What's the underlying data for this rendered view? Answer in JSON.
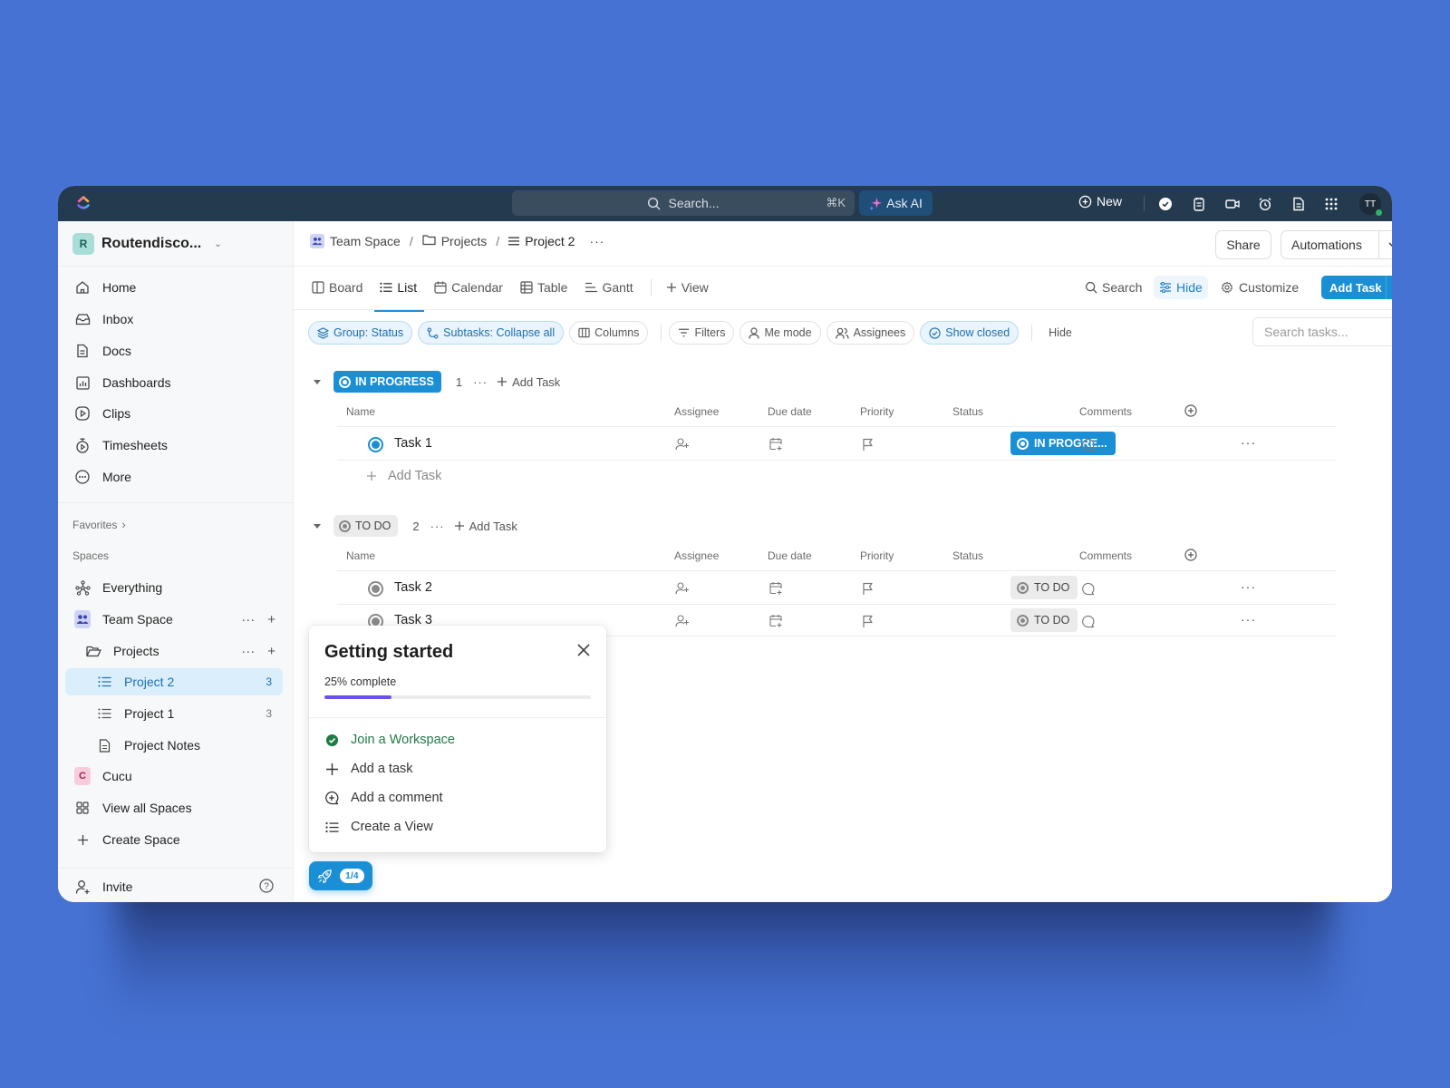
{
  "topbar": {
    "search_placeholder": "Search...",
    "search_shortcut": "⌘K",
    "ask_ai_label": "Ask AI",
    "new_label": "New",
    "icons": [
      "check-circle-icon",
      "notepad-icon",
      "video-icon",
      "alarm-clock-icon",
      "document-icon",
      "apps-grid-icon"
    ],
    "user_initials": "TT"
  },
  "sidebar": {
    "workspace": {
      "initial": "R",
      "name": "Routendisco..."
    },
    "nav": [
      {
        "label": "Home",
        "icon": "home-icon"
      },
      {
        "label": "Inbox",
        "icon": "inbox-icon"
      },
      {
        "label": "Docs",
        "icon": "docs-icon"
      },
      {
        "label": "Dashboards",
        "icon": "dashboards-icon"
      },
      {
        "label": "Clips",
        "icon": "clips-icon"
      },
      {
        "label": "Timesheets",
        "icon": "timer-icon"
      },
      {
        "label": "More",
        "icon": "more-icon"
      }
    ],
    "favorites_label": "Favorites",
    "spaces_label": "Spaces",
    "spaces": [
      {
        "label": "Everything",
        "icon": "everything-icon"
      },
      {
        "label": "Team Space",
        "icon": "team-icon"
      },
      {
        "label": "Projects",
        "icon": "folder-icon"
      },
      {
        "label": "Project 2",
        "icon": "list-icon",
        "count": "3",
        "active": true
      },
      {
        "label": "Project 1",
        "icon": "list-icon",
        "count": "3"
      },
      {
        "label": "Project Notes",
        "icon": "doc-icon"
      },
      {
        "label": "Cucu",
        "initial": "C"
      },
      {
        "label": "View all Spaces",
        "icon": "grid-icon"
      },
      {
        "label": "Create Space",
        "icon": "plus-icon"
      }
    ],
    "invite_label": "Invite"
  },
  "header": {
    "breadcrumb": [
      "Team Space",
      "Projects",
      "Project 2"
    ],
    "share_label": "Share",
    "automations_label": "Automations"
  },
  "views": {
    "tabs": [
      {
        "label": "Board"
      },
      {
        "label": "List",
        "active": true
      },
      {
        "label": "Calendar"
      },
      {
        "label": "Table"
      },
      {
        "label": "Gantt"
      }
    ],
    "add_view_label": "View",
    "search_label": "Search",
    "hide_label": "Hide",
    "customize_label": "Customize",
    "add_task_label": "Add Task"
  },
  "filters": {
    "group": "Group: Status",
    "subtasks": "Subtasks: Collapse all",
    "columns": "Columns",
    "filters": "Filters",
    "me_mode": "Me mode",
    "assignees": "Assignees",
    "show_closed": "Show closed",
    "hide": "Hide",
    "search_placeholder": "Search tasks..."
  },
  "columns": [
    "Name",
    "Assignee",
    "Due date",
    "Priority",
    "Status",
    "Comments"
  ],
  "groups": [
    {
      "status": "IN PROGRESS",
      "count": "1",
      "add_label": "Add Task",
      "color": "#1b8fd6",
      "tasks": [
        {
          "name": "Task 1",
          "status": "IN PROGRE..."
        }
      ],
      "add_row_label": "Add Task"
    },
    {
      "status": "TO DO",
      "count": "2",
      "add_label": "Add Task",
      "color": "#8a8a8a",
      "tasks": [
        {
          "name": "Task 2",
          "status": "TO DO"
        },
        {
          "name": "Task 3",
          "status": "TO DO"
        }
      ]
    }
  ],
  "getting_started": {
    "title": "Getting started",
    "progress_label": "25% complete",
    "progress": 0.25,
    "items": [
      {
        "label": "Join a Workspace",
        "done": true
      },
      {
        "label": "Add a task",
        "done": false
      },
      {
        "label": "Add a comment",
        "done": false
      },
      {
        "label": "Create a View",
        "done": false
      }
    ],
    "badge": "1/4"
  },
  "colors": {
    "accent": "#1b8fd6",
    "topbar": "#243a4f",
    "background": "#4672d3",
    "progress": "#6a52e8",
    "done_green": "#1f7a45"
  }
}
